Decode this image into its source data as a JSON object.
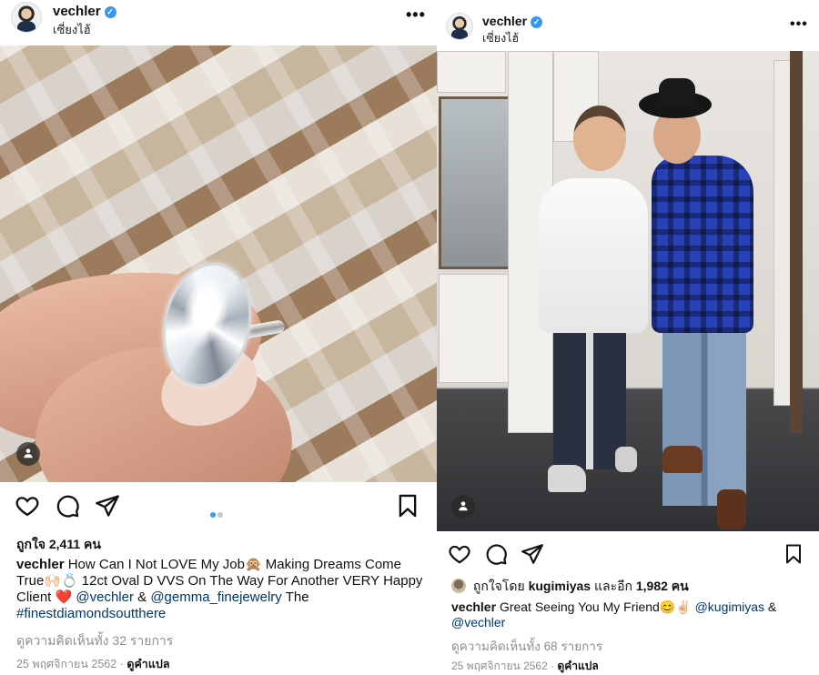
{
  "left_post": {
    "username": "vechler",
    "verified_mark": "✓",
    "location": "เซี่ยงไฮ้",
    "more_label": "•••",
    "tag_icon": "user-tag-icon",
    "likes": "ถูกใจ 2,411 คน",
    "caption_user": "vechler",
    "caption_text_1": "How Can I Not LOVE My Job🙊 Making Dreams Come True🙌🏻💍 12ct Oval D VVS On The Way For Another VERY Happy Client ❤️",
    "mention_1": "@vechler",
    "caption_amp": "&",
    "mention_2": "@gemma_finejewelry",
    "caption_text_2": "The",
    "hashtag": "#finestdiamondsoutthere",
    "view_comments": "ดูความคิดเห็นทั้ง 32 รายการ",
    "date": "25 พฤศจิกายน 2562",
    "separator": "·",
    "translate": "ดูคำแปล",
    "carousel_dots": 2,
    "colors": {
      "active_dot": "#3897f0",
      "inactive_dot": "#c7c7c7"
    }
  },
  "right_post": {
    "username": "vechler",
    "verified_mark": "✓",
    "location": "เซี่ยงไฮ้",
    "more_label": "•••",
    "tag_icon": "user-tag-icon",
    "liked_by_prefix": "ถูกใจโดย",
    "liked_by_user": "kugimiyas",
    "liked_by_suffix": "และอีก",
    "liked_by_count": "1,982 คน",
    "caption_user": "vechler",
    "caption_text": "Great Seeing You My Friend😊✌🏻",
    "mention_1": "@kugimiyas",
    "caption_amp": "&",
    "mention_2": "@vechler",
    "view_comments": "ดูความคิดเห็นทั้ง 68 รายการ",
    "date": "25 พฤศจิกายน 2562",
    "separator": "·",
    "translate": "ดูคำแปล"
  },
  "icons": [
    "heart-icon",
    "comment-icon",
    "share-icon",
    "bookmark-icon"
  ]
}
